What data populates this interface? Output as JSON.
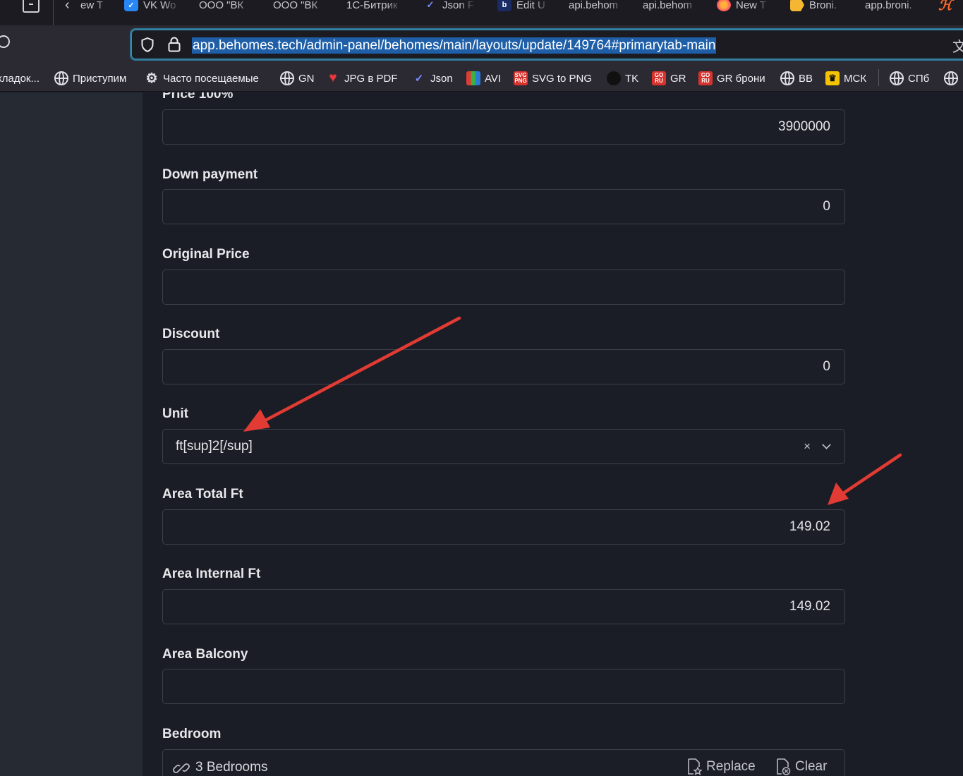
{
  "browser": {
    "tabs": [
      {
        "label": "ew T",
        "icon": "tab-icon"
      },
      {
        "label": "VK Wo",
        "icon": "vk-workspace-icon",
        "color": "#2787f5"
      },
      {
        "label": "ООО \"ВК",
        "icon": ""
      },
      {
        "label": "ООО \"ВК",
        "icon": ""
      },
      {
        "label": "1С-Битрик",
        "icon": ""
      },
      {
        "label": "Json F",
        "icon": "json-check-icon"
      },
      {
        "label": "Edit U",
        "icon": "edit-icon"
      },
      {
        "label": "api.behom",
        "icon": ""
      },
      {
        "label": "api.behom",
        "icon": ""
      },
      {
        "label": "New T",
        "icon": "firefox-icon"
      },
      {
        "label": "Broni.",
        "icon": "tag-icon",
        "color": "#f5b731"
      },
      {
        "label": "app.broni.",
        "icon": ""
      }
    ],
    "url": "app.behomes.tech/admin-panel/behomes/main/layouts/update/149764#primarytab-main",
    "bookmarks": [
      {
        "label": "кладок...",
        "icon": "none"
      },
      {
        "label": "Приступим",
        "icon": "globe-icon"
      },
      {
        "label": "Часто посещаемые",
        "icon": "gear-icon"
      },
      {
        "label": "GN",
        "icon": "globe-icon"
      },
      {
        "label": "JPG в PDF",
        "icon": "heart-icon"
      },
      {
        "label": "Json",
        "icon": "check-icon"
      },
      {
        "label": "AVI",
        "icon": "chart-icon"
      },
      {
        "label": "SVG to PNG",
        "icon": "svg-png-icon"
      },
      {
        "label": "TK",
        "icon": "circle-icon"
      },
      {
        "label": "GR",
        "icon": "goru-icon"
      },
      {
        "label": "GR брони",
        "icon": "goru-icon"
      },
      {
        "label": "BB",
        "icon": "globe-icon"
      },
      {
        "label": "МСК",
        "icon": "crown-icon"
      },
      {
        "label": "СПб",
        "icon": "globe-icon"
      }
    ],
    "bookmark_icon_text": {
      "svg_png": "SVG\nPNG",
      "goru": "GO\nRU"
    }
  },
  "form": {
    "price_label": "Price 100%",
    "price_value": "3900000",
    "down_payment_label": "Down payment",
    "down_payment_value": "0",
    "original_price_label": "Original Price",
    "original_price_value": "",
    "discount_label": "Discount",
    "discount_value": "0",
    "unit_label": "Unit",
    "unit_value": "ft[sup]2[/sup]",
    "unit_clear": "×",
    "area_total_label": "Area Total Ft",
    "area_total_value": "149.02",
    "area_internal_label": "Area Internal Ft",
    "area_internal_value": "149.02",
    "area_balcony_label": "Area Balcony",
    "area_balcony_value": "",
    "bedroom_label": "Bedroom",
    "bedroom_value": "3 Bedrooms",
    "bedroom_replace": "Replace",
    "bedroom_clear": "Clear"
  },
  "colors": {
    "annotation_arrow": "#e23b33",
    "url_highlight": "#1f5fa8",
    "urlbar_focus": "#2f7a99"
  }
}
